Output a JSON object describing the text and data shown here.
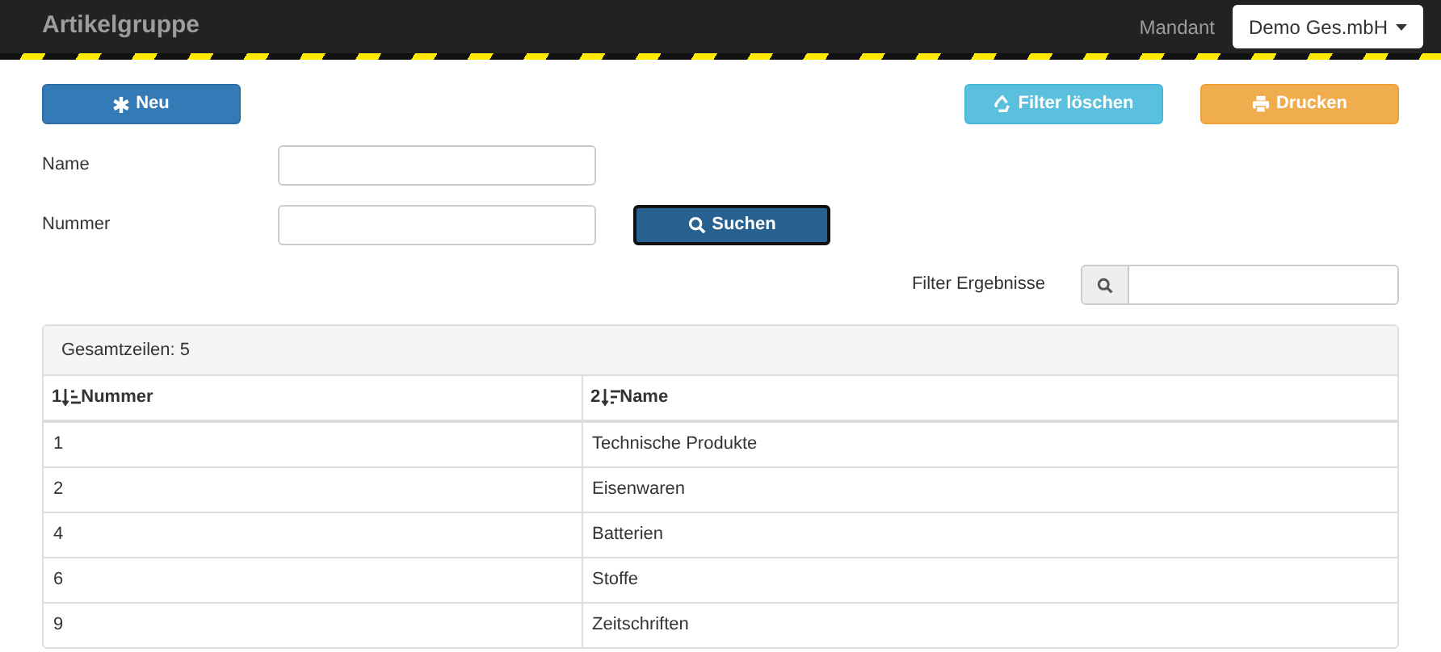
{
  "navbar": {
    "title": "Artikelgruppe",
    "mandant_label": "Mandant",
    "mandant_value": "Demo Ges.mbH"
  },
  "actions": [
    {
      "kind": "primary",
      "label": "Neu"
    },
    {
      "kind": "info",
      "label": "Filter löschen"
    },
    {
      "kind": "warning",
      "label": "Drucken"
    }
  ],
  "form": {
    "fields": [
      {
        "label": "Name"
      },
      {
        "label": "Nummer"
      }
    ],
    "search_button": "Suchen"
  },
  "filter": {
    "label": "Filter Ergebnisse"
  },
  "table": {
    "summary": "Gesamtzeilen: 5",
    "columns": [
      {
        "sort_order": "1",
        "label": "Nummer"
      },
      {
        "sort_order": "2",
        "label": "Name"
      }
    ],
    "rows": [
      [
        "1",
        "Technische Produkte"
      ],
      [
        "2",
        "Eisenwaren"
      ],
      [
        "4",
        "Batterien"
      ],
      [
        "6",
        "Stoffe"
      ],
      [
        "9",
        "Zeitschriften"
      ]
    ]
  }
}
